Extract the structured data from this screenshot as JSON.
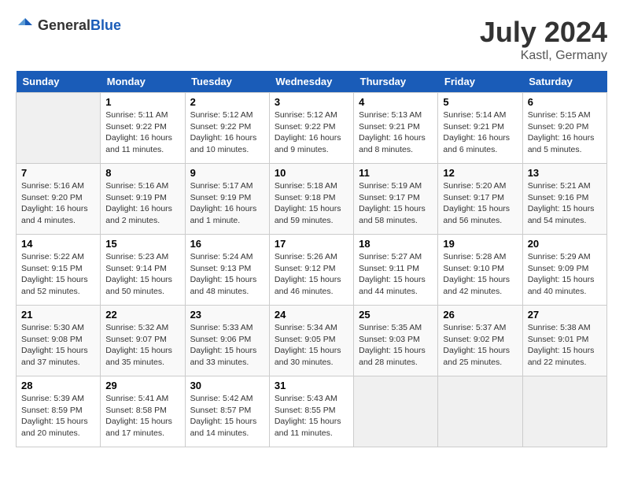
{
  "header": {
    "logo_general": "General",
    "logo_blue": "Blue",
    "month_year": "July 2024",
    "location": "Kastl, Germany"
  },
  "calendar": {
    "days_of_week": [
      "Sunday",
      "Monday",
      "Tuesday",
      "Wednesday",
      "Thursday",
      "Friday",
      "Saturday"
    ],
    "weeks": [
      [
        {
          "day": "",
          "info": ""
        },
        {
          "day": "1",
          "info": "Sunrise: 5:11 AM\nSunset: 9:22 PM\nDaylight: 16 hours\nand 11 minutes."
        },
        {
          "day": "2",
          "info": "Sunrise: 5:12 AM\nSunset: 9:22 PM\nDaylight: 16 hours\nand 10 minutes."
        },
        {
          "day": "3",
          "info": "Sunrise: 5:12 AM\nSunset: 9:22 PM\nDaylight: 16 hours\nand 9 minutes."
        },
        {
          "day": "4",
          "info": "Sunrise: 5:13 AM\nSunset: 9:21 PM\nDaylight: 16 hours\nand 8 minutes."
        },
        {
          "day": "5",
          "info": "Sunrise: 5:14 AM\nSunset: 9:21 PM\nDaylight: 16 hours\nand 6 minutes."
        },
        {
          "day": "6",
          "info": "Sunrise: 5:15 AM\nSunset: 9:20 PM\nDaylight: 16 hours\nand 5 minutes."
        }
      ],
      [
        {
          "day": "7",
          "info": "Sunrise: 5:16 AM\nSunset: 9:20 PM\nDaylight: 16 hours\nand 4 minutes."
        },
        {
          "day": "8",
          "info": "Sunrise: 5:16 AM\nSunset: 9:19 PM\nDaylight: 16 hours\nand 2 minutes."
        },
        {
          "day": "9",
          "info": "Sunrise: 5:17 AM\nSunset: 9:19 PM\nDaylight: 16 hours\nand 1 minute."
        },
        {
          "day": "10",
          "info": "Sunrise: 5:18 AM\nSunset: 9:18 PM\nDaylight: 15 hours\nand 59 minutes."
        },
        {
          "day": "11",
          "info": "Sunrise: 5:19 AM\nSunset: 9:17 PM\nDaylight: 15 hours\nand 58 minutes."
        },
        {
          "day": "12",
          "info": "Sunrise: 5:20 AM\nSunset: 9:17 PM\nDaylight: 15 hours\nand 56 minutes."
        },
        {
          "day": "13",
          "info": "Sunrise: 5:21 AM\nSunset: 9:16 PM\nDaylight: 15 hours\nand 54 minutes."
        }
      ],
      [
        {
          "day": "14",
          "info": "Sunrise: 5:22 AM\nSunset: 9:15 PM\nDaylight: 15 hours\nand 52 minutes."
        },
        {
          "day": "15",
          "info": "Sunrise: 5:23 AM\nSunset: 9:14 PM\nDaylight: 15 hours\nand 50 minutes."
        },
        {
          "day": "16",
          "info": "Sunrise: 5:24 AM\nSunset: 9:13 PM\nDaylight: 15 hours\nand 48 minutes."
        },
        {
          "day": "17",
          "info": "Sunrise: 5:26 AM\nSunset: 9:12 PM\nDaylight: 15 hours\nand 46 minutes."
        },
        {
          "day": "18",
          "info": "Sunrise: 5:27 AM\nSunset: 9:11 PM\nDaylight: 15 hours\nand 44 minutes."
        },
        {
          "day": "19",
          "info": "Sunrise: 5:28 AM\nSunset: 9:10 PM\nDaylight: 15 hours\nand 42 minutes."
        },
        {
          "day": "20",
          "info": "Sunrise: 5:29 AM\nSunset: 9:09 PM\nDaylight: 15 hours\nand 40 minutes."
        }
      ],
      [
        {
          "day": "21",
          "info": "Sunrise: 5:30 AM\nSunset: 9:08 PM\nDaylight: 15 hours\nand 37 minutes."
        },
        {
          "day": "22",
          "info": "Sunrise: 5:32 AM\nSunset: 9:07 PM\nDaylight: 15 hours\nand 35 minutes."
        },
        {
          "day": "23",
          "info": "Sunrise: 5:33 AM\nSunset: 9:06 PM\nDaylight: 15 hours\nand 33 minutes."
        },
        {
          "day": "24",
          "info": "Sunrise: 5:34 AM\nSunset: 9:05 PM\nDaylight: 15 hours\nand 30 minutes."
        },
        {
          "day": "25",
          "info": "Sunrise: 5:35 AM\nSunset: 9:03 PM\nDaylight: 15 hours\nand 28 minutes."
        },
        {
          "day": "26",
          "info": "Sunrise: 5:37 AM\nSunset: 9:02 PM\nDaylight: 15 hours\nand 25 minutes."
        },
        {
          "day": "27",
          "info": "Sunrise: 5:38 AM\nSunset: 9:01 PM\nDaylight: 15 hours\nand 22 minutes."
        }
      ],
      [
        {
          "day": "28",
          "info": "Sunrise: 5:39 AM\nSunset: 8:59 PM\nDaylight: 15 hours\nand 20 minutes."
        },
        {
          "day": "29",
          "info": "Sunrise: 5:41 AM\nSunset: 8:58 PM\nDaylight: 15 hours\nand 17 minutes."
        },
        {
          "day": "30",
          "info": "Sunrise: 5:42 AM\nSunset: 8:57 PM\nDaylight: 15 hours\nand 14 minutes."
        },
        {
          "day": "31",
          "info": "Sunrise: 5:43 AM\nSunset: 8:55 PM\nDaylight: 15 hours\nand 11 minutes."
        },
        {
          "day": "",
          "info": ""
        },
        {
          "day": "",
          "info": ""
        },
        {
          "day": "",
          "info": ""
        }
      ]
    ]
  }
}
